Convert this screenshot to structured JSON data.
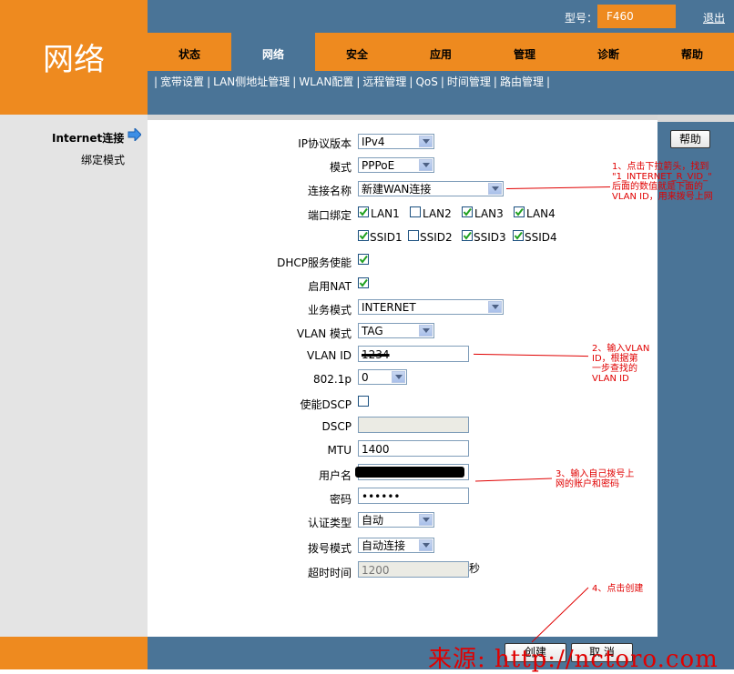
{
  "header": {
    "section_title": "网络",
    "model_label": "型号：",
    "model_value": "F460",
    "logout": "退出"
  },
  "tabs": [
    {
      "label": "状态",
      "active": false
    },
    {
      "label": "网络",
      "active": true
    },
    {
      "label": "安全",
      "active": false
    },
    {
      "label": "应用",
      "active": false
    },
    {
      "label": "管理",
      "active": false
    },
    {
      "label": "诊断",
      "active": false
    },
    {
      "label": "帮助",
      "active": false
    }
  ],
  "subnav": {
    "prefix": "|",
    "items": [
      "宽带设置",
      "LAN侧地址管理",
      "WLAN配置",
      "远程管理",
      "QoS",
      "时间管理",
      "路由管理"
    ],
    "separator": "|"
  },
  "sidebar": {
    "items": [
      "Internet连接",
      "绑定模式"
    ]
  },
  "help_button": "帮助",
  "form": {
    "ip_version": {
      "label": "IP协议版本",
      "value": "IPv4"
    },
    "mode": {
      "label": "模式",
      "value": "PPPoE"
    },
    "connection_name": {
      "label": "连接名称",
      "value": "新建WAN连接"
    },
    "port_binding": {
      "label": "端口绑定",
      "ports": [
        {
          "name": "LAN1",
          "checked": true
        },
        {
          "name": "LAN2",
          "checked": false
        },
        {
          "name": "LAN3",
          "checked": true
        },
        {
          "name": "LAN4",
          "checked": true
        },
        {
          "name": "SSID1",
          "checked": true
        },
        {
          "name": "SSID2",
          "checked": false
        },
        {
          "name": "SSID3",
          "checked": true
        },
        {
          "name": "SSID4",
          "checked": true
        }
      ]
    },
    "dhcp": {
      "label": "DHCP服务使能",
      "checked": true
    },
    "nat": {
      "label": "启用NAT",
      "checked": true
    },
    "service_mode": {
      "label": "业务模式",
      "value": "INTERNET"
    },
    "vlan_mode": {
      "label": "VLAN 模式",
      "value": "TAG"
    },
    "vlan_id": {
      "label": "VLAN ID",
      "value": "1234"
    },
    "p8021": {
      "label": "802.1p",
      "value": "0"
    },
    "dscp_enable": {
      "label": "使能DSCP",
      "checked": false
    },
    "dscp": {
      "label": "DSCP",
      "value": ""
    },
    "mtu": {
      "label": "MTU",
      "value": "1400"
    },
    "username": {
      "label": "用户名",
      "value": ""
    },
    "password": {
      "label": "密码",
      "value": "••••••"
    },
    "auth_type": {
      "label": "认证类型",
      "value": "自动"
    },
    "dial_mode": {
      "label": "拨号模式",
      "value": "自动连接"
    },
    "timeout": {
      "label": "超时时间",
      "value": "1200",
      "unit": "秒"
    }
  },
  "buttons": {
    "create": "创建",
    "cancel": "取 消"
  },
  "annotations": {
    "note1": [
      "1、点击下拉箭头，找到",
      "\"1_INTERNET_R_VID_\"",
      "后面的数值就是下面的",
      "VLAN ID，用来拨号上网"
    ],
    "note2": [
      "2、输入VLAN",
      "ID，根据第",
      "一步查找的",
      "VLAN ID"
    ],
    "note3": [
      "3、输入自己拨号上",
      "网的账户和密码"
    ],
    "note4": "4、点击创建",
    "watermark": "来源: http://nctoro.com"
  },
  "colors": {
    "orange": "#ee8a1f",
    "blue": "#4a7497",
    "annotation_red": "#e00000"
  }
}
